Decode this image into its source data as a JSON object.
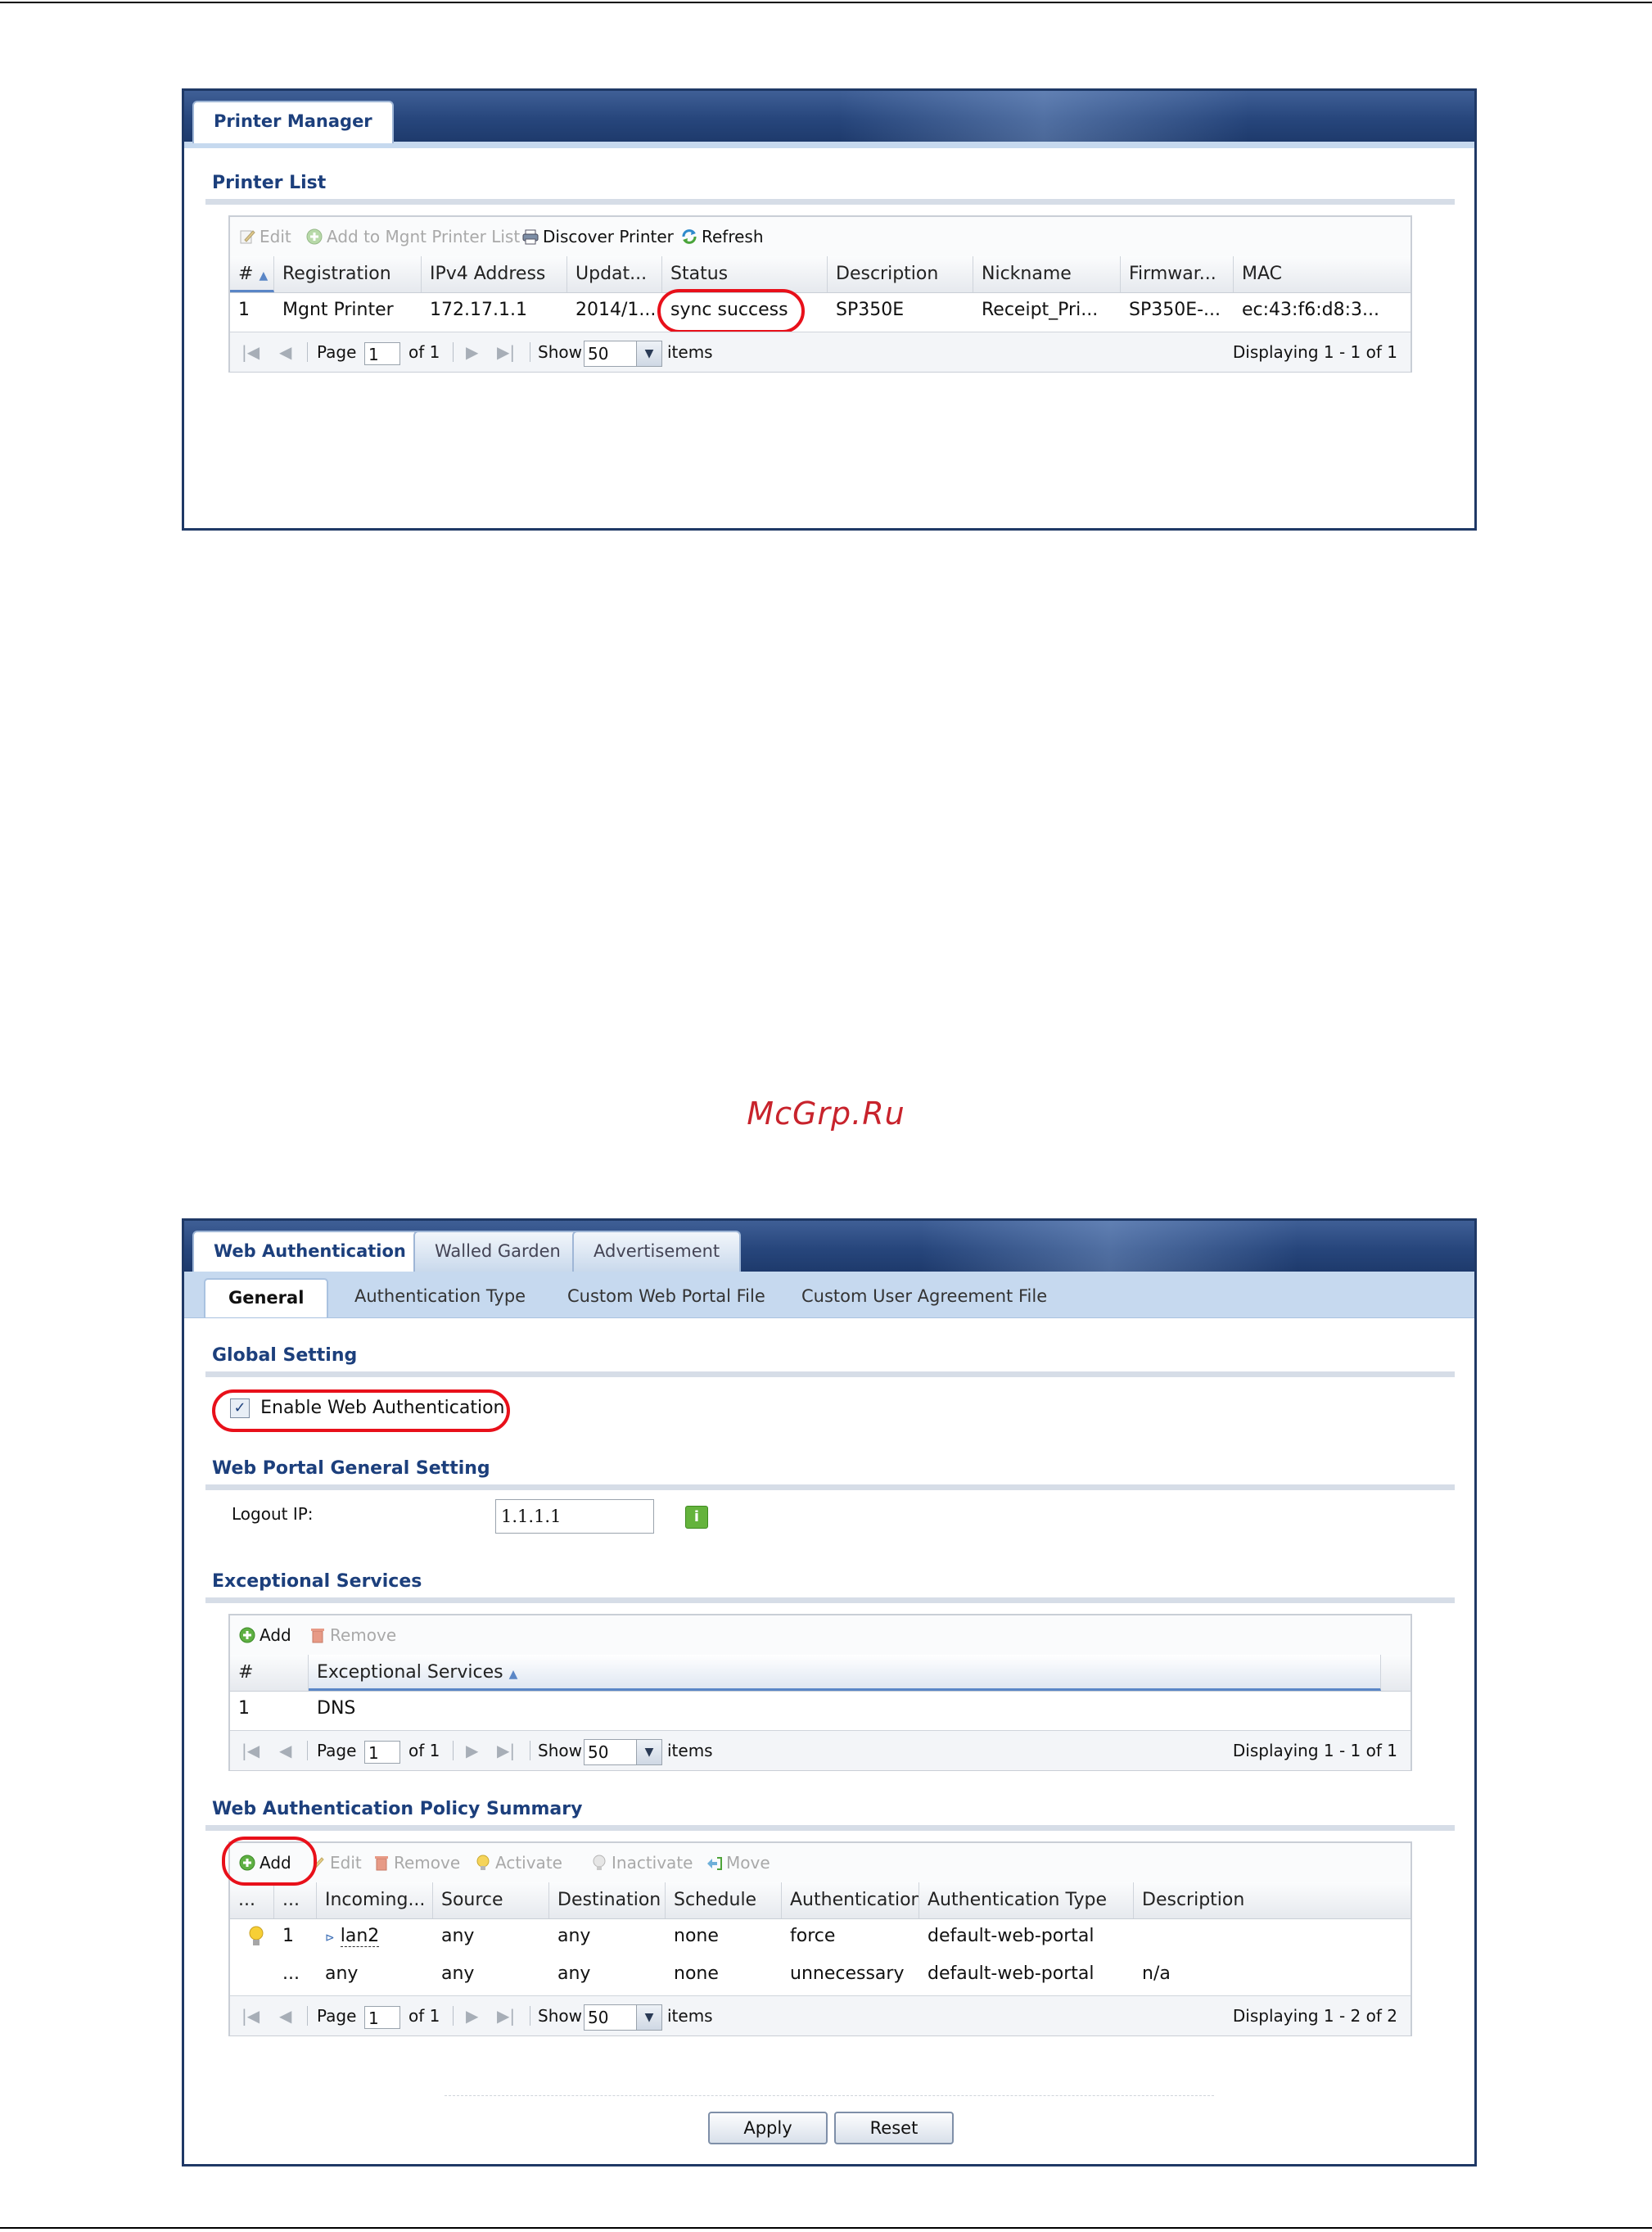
{
  "watermark": "McGrp.Ru",
  "printer_window": {
    "tab": "Printer Manager",
    "section_title": "Printer List",
    "toolbar": {
      "edit": "Edit",
      "add_to_mgnt": "Add to Mgnt Printer List",
      "discover": "Discover Printer",
      "refresh": "Refresh"
    },
    "columns": [
      "#",
      "Registration",
      "IPv4 Address",
      "Updat...",
      "Status",
      "Description",
      "Nickname",
      "Firmwar...",
      "MAC"
    ],
    "rows": [
      [
        "1",
        "Mgnt Printer",
        "172.17.1.1",
        "2014/1...",
        "sync success",
        "SP350E",
        "Receipt_Pri...",
        "SP350E-...",
        "ec:43:f6:d8:3..."
      ]
    ],
    "pager": {
      "page_label": "Page",
      "page_value": "1",
      "of": "of 1",
      "show": "Show",
      "per_page": "50",
      "items": "items",
      "displaying": "Displaying 1 - 1 of 1"
    }
  },
  "web_auth_window": {
    "tabs": [
      "Web Authentication",
      "Walled Garden",
      "Advertisement"
    ],
    "subtabs": [
      "General",
      "Authentication Type",
      "Custom Web Portal File",
      "Custom User Agreement File"
    ],
    "global_setting": {
      "title": "Global Setting",
      "enable_label": "Enable Web Authentication",
      "enabled": true
    },
    "portal_setting": {
      "title": "Web Portal General Setting",
      "logout_ip_label": "Logout IP:",
      "logout_ip_value": "1.1.1.1",
      "info_icon": "i"
    },
    "exceptional": {
      "title": "Exceptional Services",
      "toolbar": {
        "add": "Add",
        "remove": "Remove"
      },
      "columns": [
        "#",
        "Exceptional Services"
      ],
      "rows": [
        [
          "1",
          "DNS"
        ]
      ],
      "pager": {
        "page_label": "Page",
        "page_value": "1",
        "of": "of 1",
        "show": "Show",
        "per_page": "50",
        "items": "items",
        "displaying": "Displaying 1 - 1 of 1"
      }
    },
    "policy": {
      "title": "Web Authentication Policy Summary",
      "toolbar": {
        "add": "Add",
        "edit": "Edit",
        "remove": "Remove",
        "activate": "Activate",
        "inactivate": "Inactivate",
        "move": "Move"
      },
      "columns": [
        "...",
        "...",
        "Incoming...",
        "Source",
        "Destination",
        "Schedule",
        "Authentication",
        "Authentication Type",
        "Description"
      ],
      "rows": [
        [
          "",
          "1",
          "lan2",
          "any",
          "any",
          "none",
          "force",
          "default-web-portal",
          ""
        ],
        [
          "",
          "...",
          "any",
          "any",
          "any",
          "none",
          "unnecessary",
          "default-web-portal",
          "n/a"
        ]
      ],
      "pager": {
        "page_label": "Page",
        "page_value": "1",
        "of": "of 1",
        "show": "Show",
        "per_page": "50",
        "items": "items",
        "displaying": "Displaying 1 - 2 of 2"
      }
    },
    "buttons": {
      "apply": "Apply",
      "reset": "Reset"
    }
  },
  "colors": {
    "highlight": "#e8101a",
    "title_blue": "#1c3f7c",
    "frame": "#1f3966"
  }
}
